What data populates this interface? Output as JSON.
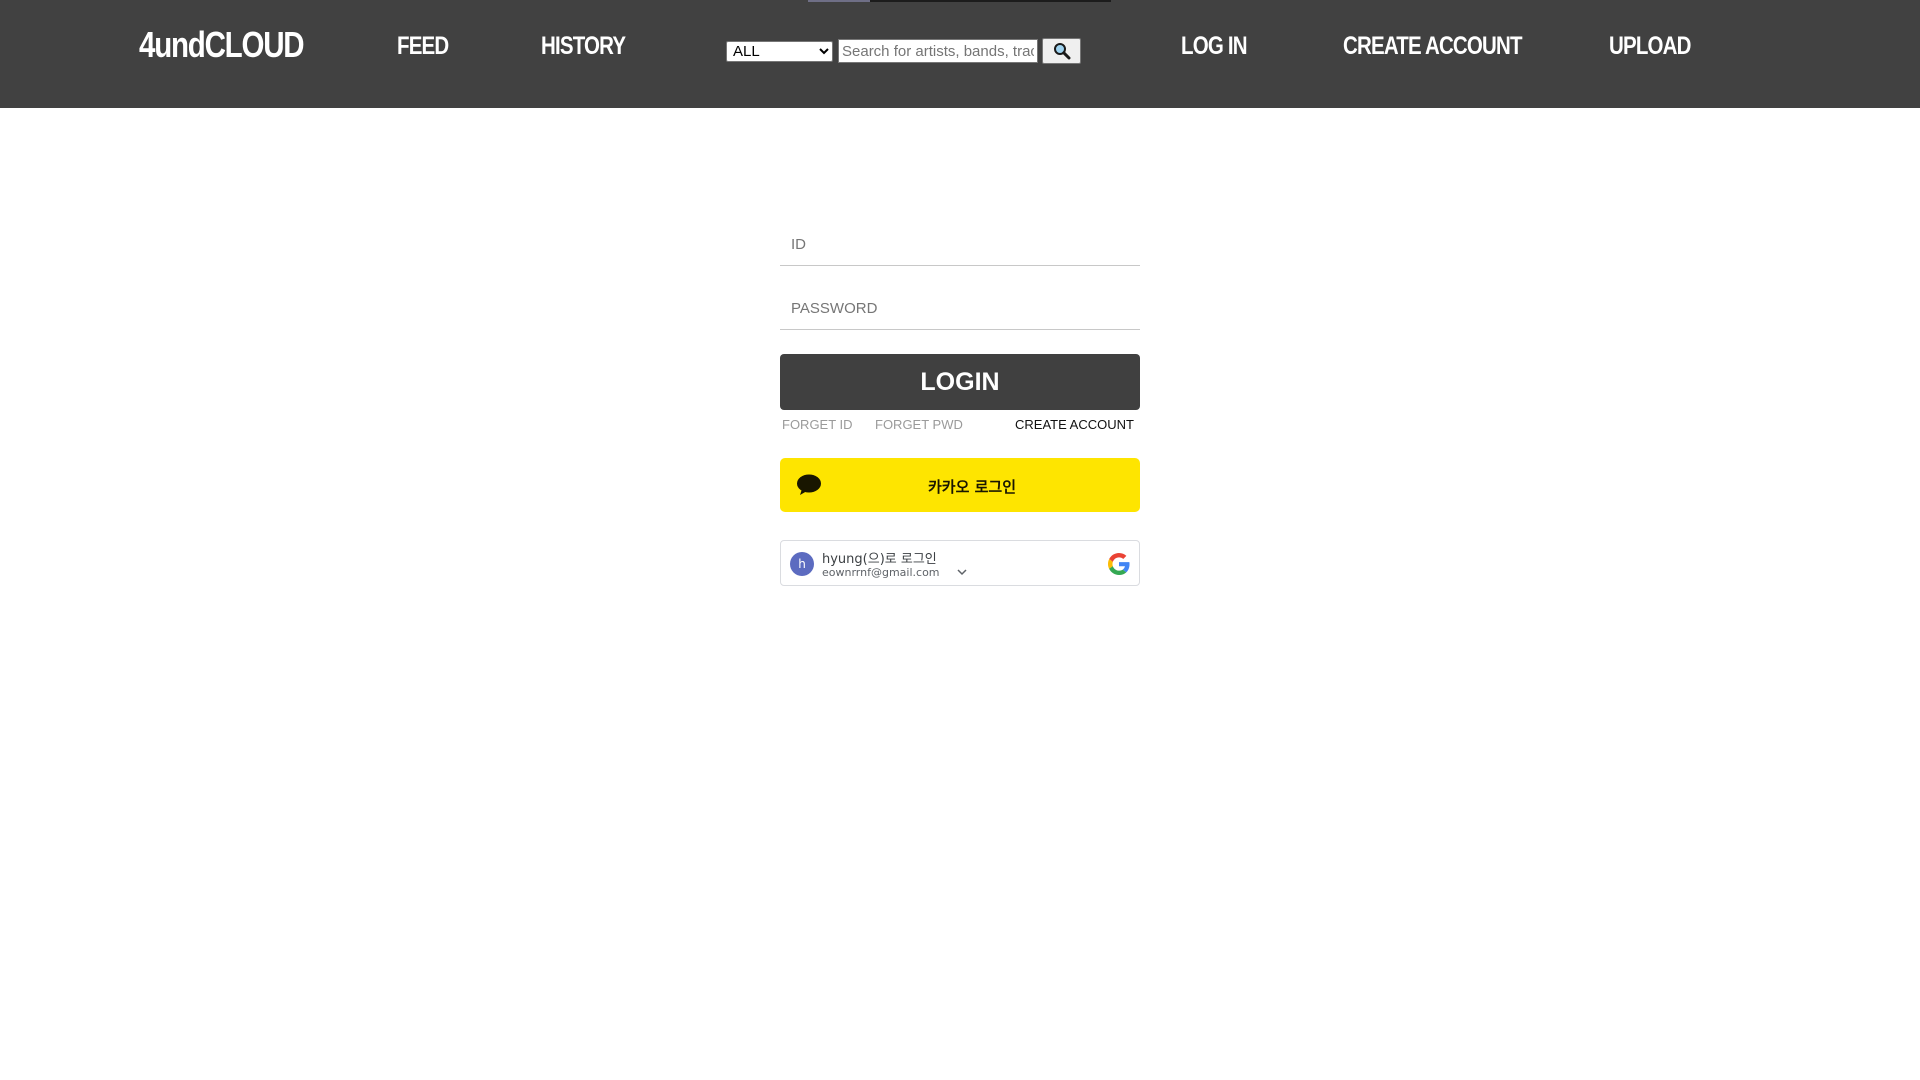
{
  "header": {
    "brand": "4undCLOUD",
    "nav": {
      "feed": "FEED",
      "history": "HISTORY",
      "log_in": "LOG IN",
      "create_account": "CREATE ACCOUNT",
      "upload": "UPLOAD"
    },
    "search": {
      "filter_selected": "ALL",
      "placeholder": "Search for artists, bands, tracks"
    }
  },
  "login": {
    "id_placeholder": "ID",
    "password_placeholder": "PASSWORD",
    "login_label": "LOGIN",
    "forget_id": "FORGET ID",
    "forget_pwd": "FORGET PWD",
    "create_account": "CREATE ACCOUNT",
    "kakao_label": "카카오 로그인",
    "google": {
      "avatar_initial": "h",
      "name_label": "hyung(으)로 로그인",
      "email": "eownrrnf@gmail.com"
    }
  },
  "colors": {
    "header_bg": "#414141",
    "login_button_bg": "#404040",
    "kakao_yellow": "#fee500",
    "google_avatar": "#5c6bc0"
  },
  "icons": {
    "search": "magnifier-icon",
    "kakao": "speech-bubble-icon",
    "google": "google-g-icon",
    "chevron": "chevron-down-icon"
  }
}
